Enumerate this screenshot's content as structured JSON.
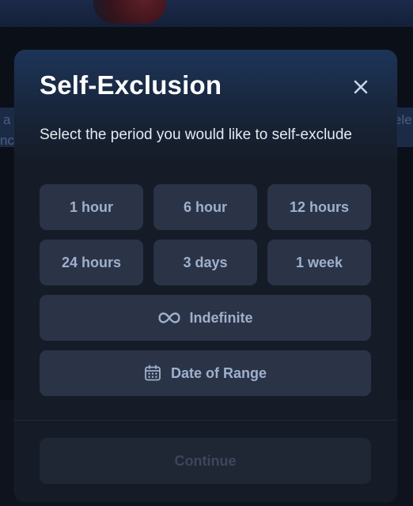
{
  "background": {
    "left_fragments": [
      "a",
      "nc"
    ],
    "right_fragment": "ele"
  },
  "modal": {
    "title": "Self-Exclusion",
    "close_icon": "close-icon",
    "subtitle": "Select the period you would like to self-exclude",
    "options": [
      {
        "label": "1 hour"
      },
      {
        "label": "6 hour"
      },
      {
        "label": "12 hours"
      },
      {
        "label": "24 hours"
      },
      {
        "label": "3 days"
      },
      {
        "label": "1 week"
      },
      {
        "label": "Indefinite",
        "icon": "infinity-icon"
      },
      {
        "label": "Date of Range",
        "icon": "calendar-icon"
      }
    ],
    "continue_label": "Continue",
    "continue_enabled": false
  },
  "colors": {
    "modal_bg": "#151c28",
    "option_bg": "#2a3446",
    "option_text": "#9fb0cd",
    "title": "#ffffff",
    "disabled_text": "#3c475b"
  }
}
